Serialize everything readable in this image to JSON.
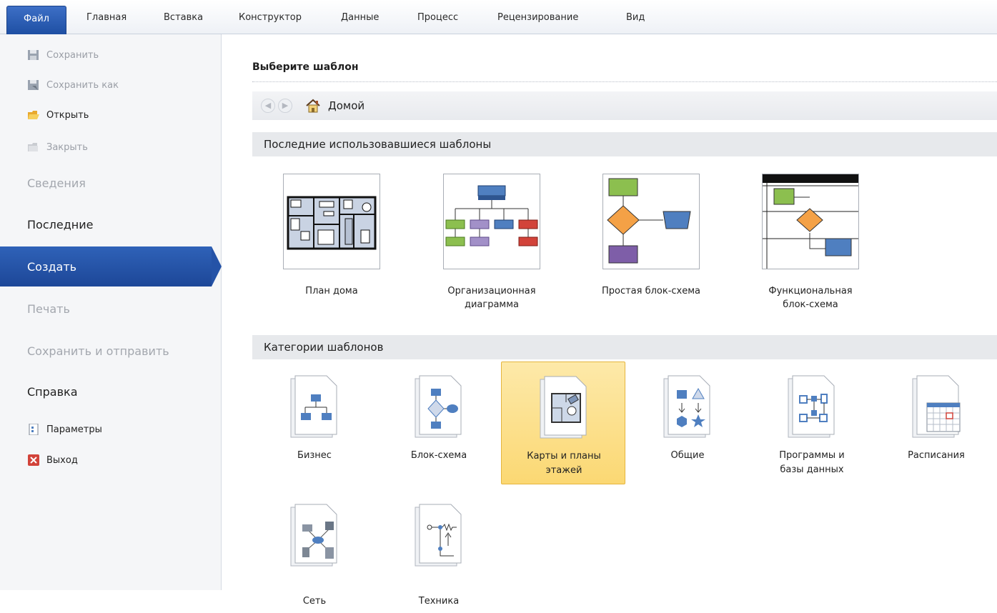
{
  "ribbon": {
    "tabs": [
      "Файл",
      "Главная",
      "Вставка",
      "Конструктор",
      "Данные",
      "Процесс",
      "Рецензирование",
      "Вид"
    ]
  },
  "backstage": {
    "commands": {
      "save": "Сохранить",
      "save_as": "Сохранить как",
      "open": "Открыть",
      "close": "Закрыть"
    },
    "items": {
      "info": "Сведения",
      "recent": "Последние",
      "new": "Создать",
      "print": "Печать",
      "save_send": "Сохранить и отправить",
      "help": "Справка"
    },
    "bottom": {
      "options": "Параметры",
      "exit": "Выход"
    }
  },
  "main": {
    "heading": "Выберите шаблон",
    "nav": {
      "home": "Домой"
    },
    "recent_section": "Последние использовавшиеся шаблоны",
    "recent": [
      {
        "label_1": "План дома",
        "label_2": ""
      },
      {
        "label_1": "Организационная",
        "label_2": "диаграмма"
      },
      {
        "label_1": "Простая блок-схема",
        "label_2": ""
      },
      {
        "label_1": "Функциональная",
        "label_2": "блок-схема"
      }
    ],
    "categories_section": "Категории шаблонов",
    "categories": [
      {
        "label_1": "Бизнес",
        "label_2": ""
      },
      {
        "label_1": "Блок-схема",
        "label_2": ""
      },
      {
        "label_1": "Карты и планы",
        "label_2": "этажей"
      },
      {
        "label_1": "Общие",
        "label_2": ""
      },
      {
        "label_1": "Программы и",
        "label_2": "базы данных"
      },
      {
        "label_1": "Расписания",
        "label_2": ""
      },
      {
        "label_1": "Сеть",
        "label_2": ""
      },
      {
        "label_1": "Техника",
        "label_2": ""
      }
    ],
    "selected_category": "Карты и планы этажей"
  },
  "colors": {
    "accent_blue": "#2553a7",
    "selected_tile": "#fbd873",
    "shape_green": "#8cbf4f",
    "shape_orange": "#f4a146",
    "shape_blue": "#4f7fc0",
    "shape_purple": "#7e5ea8",
    "shape_red": "#d2433a"
  }
}
